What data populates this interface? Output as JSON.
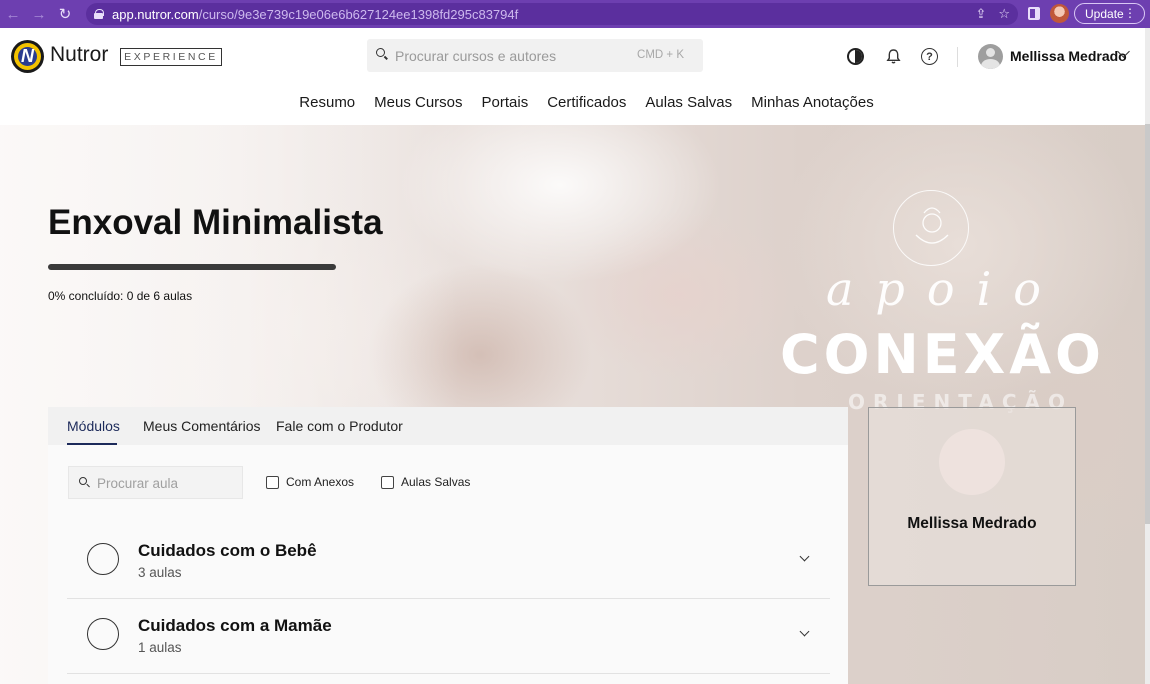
{
  "browser": {
    "url_host": "app.nutror.com",
    "url_path": "/curso/9e3e739c19e06e6b627124ee1398fd295c83794f",
    "update_label": "Update"
  },
  "header": {
    "brand": "Nutror",
    "logo_letter": "N",
    "tagline": "EXPERIENCE",
    "search_placeholder": "Procurar cursos e autores",
    "search_shortcut": "CMD + K",
    "help_glyph": "?",
    "user_name": "Mellissa Medrado"
  },
  "nav": {
    "items": [
      "Resumo",
      "Meus Cursos",
      "Portais",
      "Certificados",
      "Aulas Salvas",
      "Minhas Anotações"
    ]
  },
  "course": {
    "title": "Enxoval Minimalista",
    "progress_text": "0% concluído: 0 de 6 aulas",
    "progress_percent": 0
  },
  "banner_art": {
    "script_word": "apoio",
    "main_word": "CONEXÃO",
    "sub_word": "ORIENTAÇÃO"
  },
  "tabs": [
    "Módulos",
    "Meus Comentários",
    "Fale com o Produtor"
  ],
  "filters": {
    "lesson_search_placeholder": "Procurar aula",
    "attachments_label": "Com Anexos",
    "saved_label": "Aulas Salvas"
  },
  "modules": [
    {
      "title": "Cuidados com o Bebê",
      "count": "3 aulas"
    },
    {
      "title": "Cuidados com a Mamãe",
      "count": "1 aulas"
    }
  ],
  "producer": {
    "name": "Mellissa Medrado"
  },
  "icons": {
    "browser": [
      "back-icon",
      "forward-icon",
      "reload-icon",
      "lock-icon",
      "share-icon",
      "star-icon",
      "sidebar-icon",
      "menu-dots-icon"
    ],
    "header": [
      "nutror-logo-icon",
      "search-icon",
      "theme-toggle-icon",
      "bell-icon",
      "help-icon",
      "chevron-down-icon"
    ]
  },
  "colors": {
    "browser_bar": "#6d3fb0",
    "active_tab": "#1c2a5a",
    "progress_track": "#3a3a3a"
  }
}
